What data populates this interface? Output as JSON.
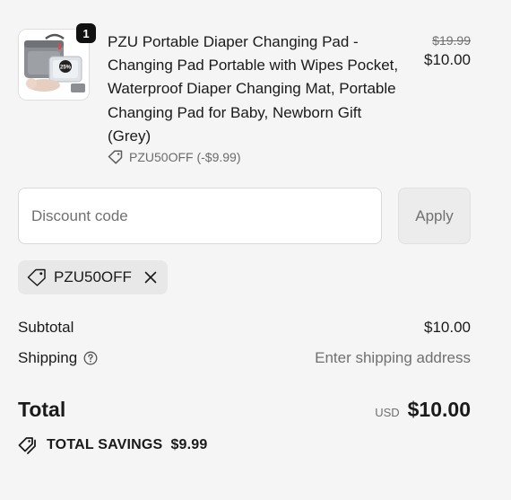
{
  "product": {
    "quantity": "1",
    "title": "PZU Portable Diaper Changing Pad -\nChanging Pad Portable with Wipes Pocket,\nWaterproof Diaper Changing Mat, Portable\nChanging Pad for Baby, Newborn Gift\n  (Grey)",
    "discount_code_applied": "PZU50OFF (-$9.99)",
    "original_price": "$19.99",
    "current_price": "$10.00",
    "image_icon": "diaper-changing-pad-product-image",
    "image_badge_text": "25%"
  },
  "discount": {
    "placeholder": "Discount code",
    "value": "",
    "apply_label": "Apply"
  },
  "applied_code": {
    "code": "PZU50OFF",
    "tag_icon": "tag-icon",
    "remove_icon": "close-icon"
  },
  "summary": {
    "subtotal_label": "Subtotal",
    "subtotal_value": "$10.00",
    "shipping_label": "Shipping",
    "shipping_value": "Enter shipping address",
    "help_icon": "question-circle-icon",
    "total_label": "Total",
    "currency": "USD",
    "total_value": "$10.00",
    "savings_label": "TOTAL SAVINGS",
    "savings_value": "$9.99",
    "savings_icon": "tags-icon"
  },
  "colors": {
    "background": "#f5f5f5",
    "text": "#1a1a1a",
    "muted": "#707070",
    "badge": "#111111",
    "chip_bg": "#e8e8e8"
  }
}
